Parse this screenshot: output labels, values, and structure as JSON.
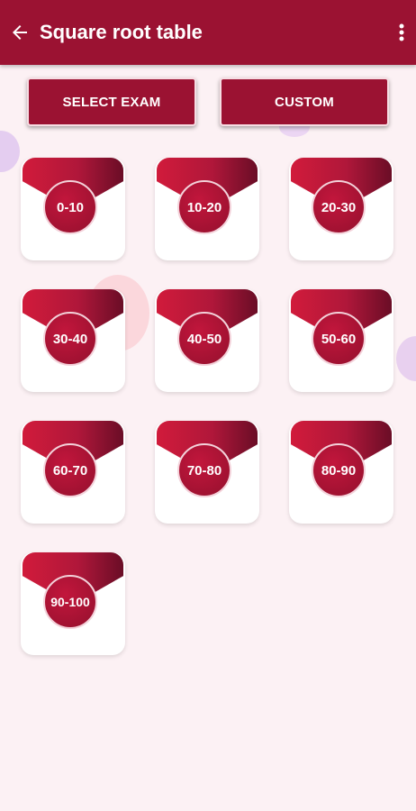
{
  "header": {
    "title": "Square root table",
    "back_icon": "arrow-left-icon",
    "menu_icon": "more-vert-icon"
  },
  "actions": {
    "select_exam": "SELECT EXAM",
    "custom": "CUSTOM"
  },
  "ranges": [
    "0-10",
    "10-20",
    "20-30",
    "30-40",
    "40-50",
    "50-60",
    "60-70",
    "70-80",
    "80-90",
    "90-100"
  ],
  "colors": {
    "primary": "#9b1232",
    "background": "#fcf1f4",
    "gradient_start": "#d11b3b",
    "gradient_end": "#6a0d26"
  }
}
